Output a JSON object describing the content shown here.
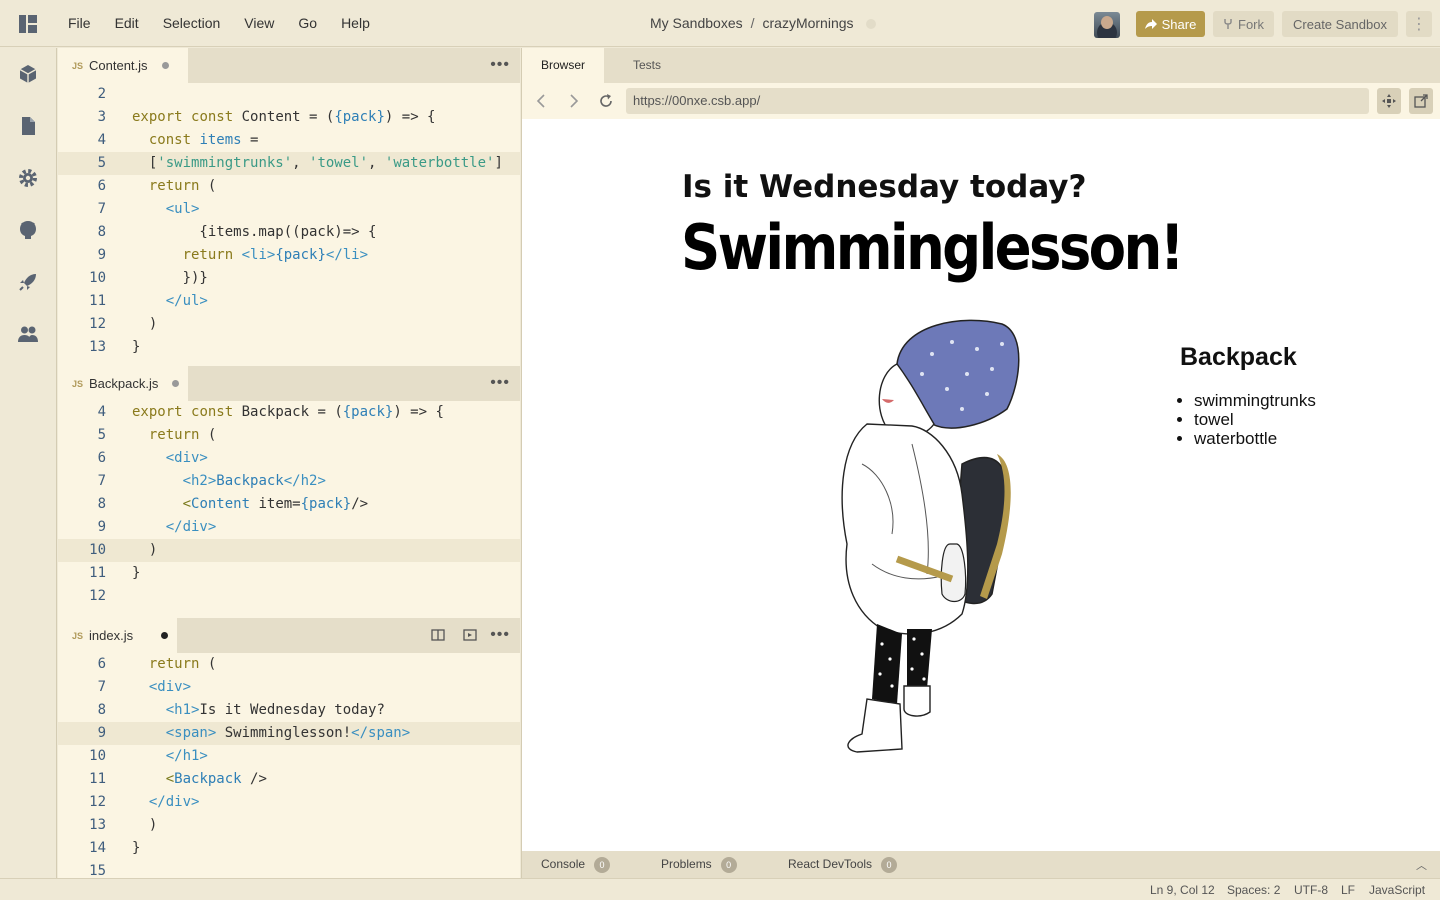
{
  "menu": [
    "File",
    "Edit",
    "Selection",
    "View",
    "Go",
    "Help"
  ],
  "breadcrumb": {
    "parent": "My Sandboxes",
    "separator": "/",
    "name": "crazyMornings"
  },
  "buttons": {
    "share": "Share",
    "fork": "Fork",
    "create": "Create Sandbox",
    "more": "⋮"
  },
  "colors": {
    "accent": "#b59a4b",
    "background": "#efe9d6",
    "editor": "#fbf5e3"
  },
  "activity_icons": [
    "cube-icon",
    "file-icon",
    "gear-icon",
    "github-icon",
    "rocket-icon",
    "users-icon"
  ],
  "panes": [
    {
      "filename": "Content.js",
      "lines": [
        {
          "n": "2",
          "code": ""
        },
        {
          "n": "3",
          "code": "export const Content = ({pack}) => {"
        },
        {
          "n": "4",
          "code": "  const items ="
        },
        {
          "n": "5",
          "code": "  ['swimmingtrunks', 'towel', 'waterbottle']"
        },
        {
          "n": "6",
          "code": "  return ("
        },
        {
          "n": "7",
          "code": "    <ul>"
        },
        {
          "n": "8",
          "code": "        {items.map((pack)=> {"
        },
        {
          "n": "9",
          "code": "      return <li>{pack}</li>"
        },
        {
          "n": "10",
          "code": "      })}"
        },
        {
          "n": "11",
          "code": "    </ul>"
        },
        {
          "n": "12",
          "code": "  )"
        },
        {
          "n": "13",
          "code": "}"
        }
      ]
    },
    {
      "filename": "Backpack.js",
      "lines": [
        {
          "n": "4",
          "code": "export const Backpack = ({pack}) => {"
        },
        {
          "n": "5",
          "code": "  return ("
        },
        {
          "n": "6",
          "code": "    <div>"
        },
        {
          "n": "7",
          "code": "      <h2>Backpack</h2>"
        },
        {
          "n": "8",
          "code": "      <Content item={pack}/>"
        },
        {
          "n": "9",
          "code": "    </div>"
        },
        {
          "n": "10",
          "code": "  )"
        },
        {
          "n": "11",
          "code": "}"
        },
        {
          "n": "12",
          "code": ""
        }
      ]
    },
    {
      "filename": "index.js",
      "lines": [
        {
          "n": "6",
          "code": "  return ("
        },
        {
          "n": "7",
          "code": "  <div>"
        },
        {
          "n": "8",
          "code": "    <h1>Is it Wednesday today?"
        },
        {
          "n": "9",
          "code": "    <span> Swimminglesson!</span>"
        },
        {
          "n": "10",
          "code": "    </h1>"
        },
        {
          "n": "11",
          "code": "    <Backpack />"
        },
        {
          "n": "12",
          "code": "  </div>"
        },
        {
          "n": "13",
          "code": "  )"
        },
        {
          "n": "14",
          "code": "}"
        },
        {
          "n": "15",
          "code": ""
        }
      ]
    }
  ],
  "browser": {
    "tabs": [
      "Browser",
      "Tests"
    ],
    "url": "https://00nxe.csb.app/",
    "heading": "Is it Wednesday today?",
    "span": "Swimminglesson!",
    "backpack_title": "Backpack",
    "items": [
      "swimmingtrunks",
      "towel",
      "waterbottle"
    ]
  },
  "console": [
    {
      "label": "Console",
      "count": "0"
    },
    {
      "label": "Problems",
      "count": "0"
    },
    {
      "label": "React DevTools",
      "count": "0"
    }
  ],
  "status": {
    "position": "Ln 9, Col 12",
    "spaces": "Spaces: 2",
    "encoding": "UTF-8",
    "eol": "LF",
    "language": "JavaScript"
  }
}
